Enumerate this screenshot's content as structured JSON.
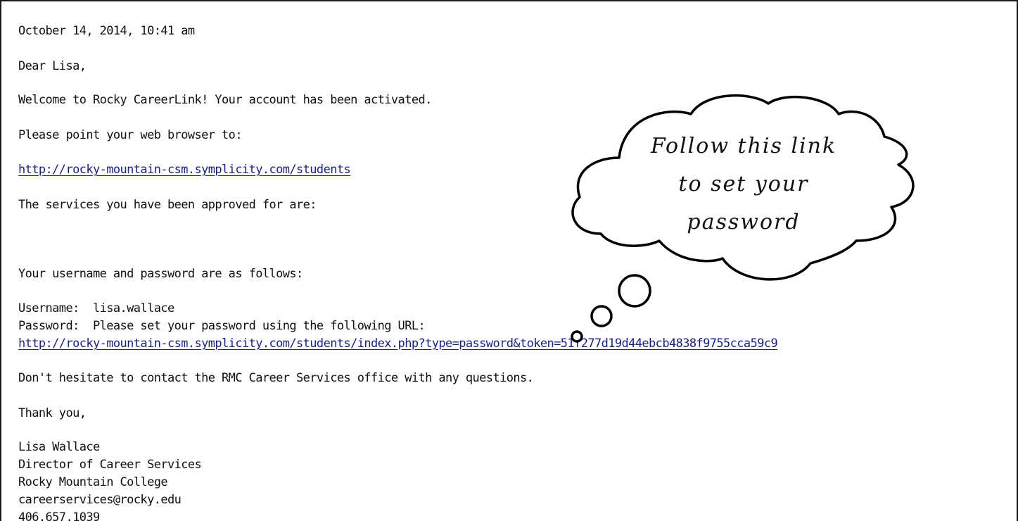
{
  "email": {
    "date": "October 14, 2014, 10:41 am",
    "greeting": "Dear Lisa,",
    "welcome": "Welcome to Rocky CareerLink! Your account has been activated.",
    "point_browser": "Please point your web browser to:",
    "students_url": "http://rocky-mountain-csm.symplicity.com/students",
    "services_line": "The services you have been approved for are:",
    "credentials_intro": "Your username and password are as follows:",
    "username_line": "Username:  lisa.wallace",
    "password_line": "Password:  Please set your password using the following URL:",
    "password_url": "http://rocky-mountain-csm.symplicity.com/students/index.php?type=password&token=51f277d19d44ebcb4838f9755cca59c9",
    "contact_line": "Don't hesitate to contact the RMC Career Services office with any questions.",
    "thanks": "Thank you,",
    "signature": {
      "name": "Lisa Wallace",
      "title": "Director of Career Services",
      "org": "Rocky Mountain College",
      "email": "careerservices@rocky.edu",
      "phone": "406.657.1039"
    }
  },
  "callout": {
    "line1": "Follow this link",
    "line2": "to set your",
    "line3": "password"
  }
}
